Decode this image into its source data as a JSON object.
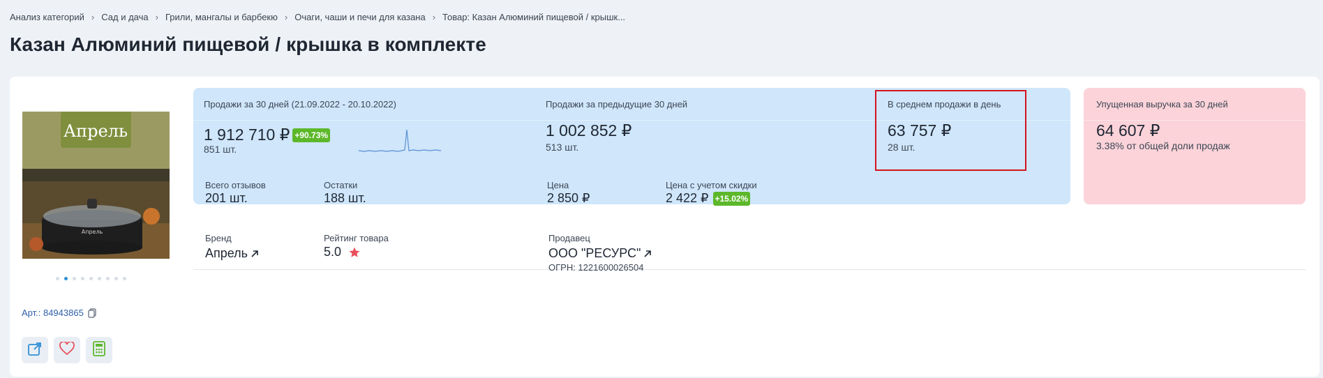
{
  "breadcrumb": [
    "Анализ категорий",
    "Сад и дача",
    "Грили, мангалы и барбекю",
    "Очаги, чаши и печи для казана",
    "Товар: Казан Алюминий пищевой / крышк..."
  ],
  "title": "Казан Алюминий пищевой / крышка в комплекте",
  "product": {
    "image_brand_text": "Апрель",
    "article_label": "Арт.: 84943865",
    "dots_total": 9,
    "dot_active": 1,
    "actions": [
      "external-link-icon",
      "heart-icon",
      "calculator-icon"
    ]
  },
  "metrics": {
    "sales30": {
      "label": "Продажи за 30 дней (21.09.2022 - 20.10.2022)",
      "value": "1 912 710 ₽",
      "badge": "+90.73%",
      "units": "851 шт."
    },
    "prev30": {
      "label": "Продажи за предыдущие 30 дней",
      "value": "1 002 852 ₽",
      "units": "513 шт."
    },
    "avg_per_day": {
      "label": "В среднем продажи в день",
      "value": "63 757 ₽",
      "units": "28 шт."
    },
    "lost_revenue": {
      "label": "Упущенная выручка за 30 дней",
      "value": "64 607 ₽",
      "sub": "3.38% от общей доли продаж"
    }
  },
  "info": {
    "reviews": {
      "label": "Всего отзывов",
      "value": "201 шт."
    },
    "stock": {
      "label": "Остатки",
      "value": "188 шт."
    },
    "price": {
      "label": "Цена",
      "value": "2 850 ₽"
    },
    "discount_price": {
      "label": "Цена с учетом скидки",
      "value": "2 422 ₽",
      "badge": "+15.02%"
    },
    "brand": {
      "label": "Бренд",
      "value": "Апрель"
    },
    "rating": {
      "label": "Рейтинг товара",
      "value": "5.0"
    },
    "seller": {
      "label": "Продавец",
      "value": "ООО \"РЕСУРС\"",
      "ogrn": "ОГРН: 1221600026504"
    }
  },
  "colors": {
    "accent_blue_panel": "#cfe6fb",
    "accent_pink_panel": "#fbd3d9",
    "badge_green": "#5cb82a",
    "highlight_red": "#d4141e",
    "star": "#e8505b"
  }
}
